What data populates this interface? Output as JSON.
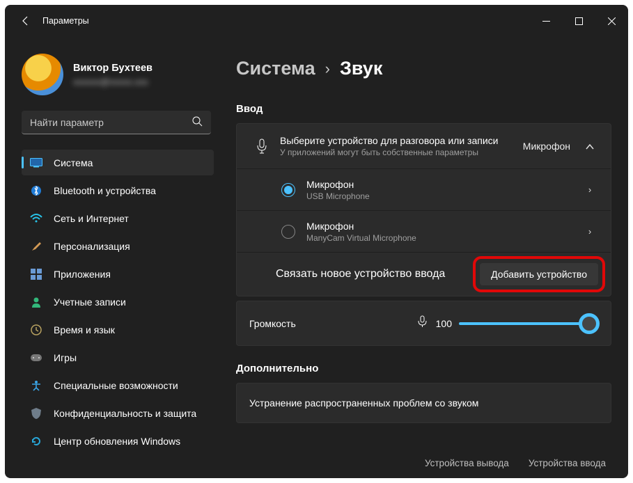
{
  "window": {
    "title": "Параметры"
  },
  "profile": {
    "name": "Виктор Бухтеев",
    "email": "xxxxxx@xxxxx.xxx"
  },
  "search": {
    "placeholder": "Найти параметр"
  },
  "nav": {
    "items": [
      "Система",
      "Bluetooth и устройства",
      "Сеть и Интернет",
      "Персонализация",
      "Приложения",
      "Учетные записи",
      "Время и язык",
      "Игры",
      "Специальные возможности",
      "Конфиденциальность и защита",
      "Центр обновления Windows"
    ]
  },
  "breadcrumb": {
    "parent": "Система",
    "current": "Звук"
  },
  "section_input": "Ввод",
  "input_header": {
    "title": "Выберите устройство для разговора или записи",
    "subtitle": "У приложений могут быть собственные параметры",
    "right": "Микрофон"
  },
  "devices": [
    {
      "name": "Микрофон",
      "sub": "USB Microphone"
    },
    {
      "name": "Микрофон",
      "sub": "ManyCam Virtual Microphone"
    }
  ],
  "pair_row": {
    "label": "Связать новое устройство ввода",
    "button": "Добавить устройство"
  },
  "volume": {
    "label": "Громкость",
    "value": "100"
  },
  "section_more": "Дополнительно",
  "troubleshoot": "Устранение распространенных проблем со звуком",
  "footer": {
    "out": "Устройства вывода",
    "in": "Устройства ввода"
  }
}
